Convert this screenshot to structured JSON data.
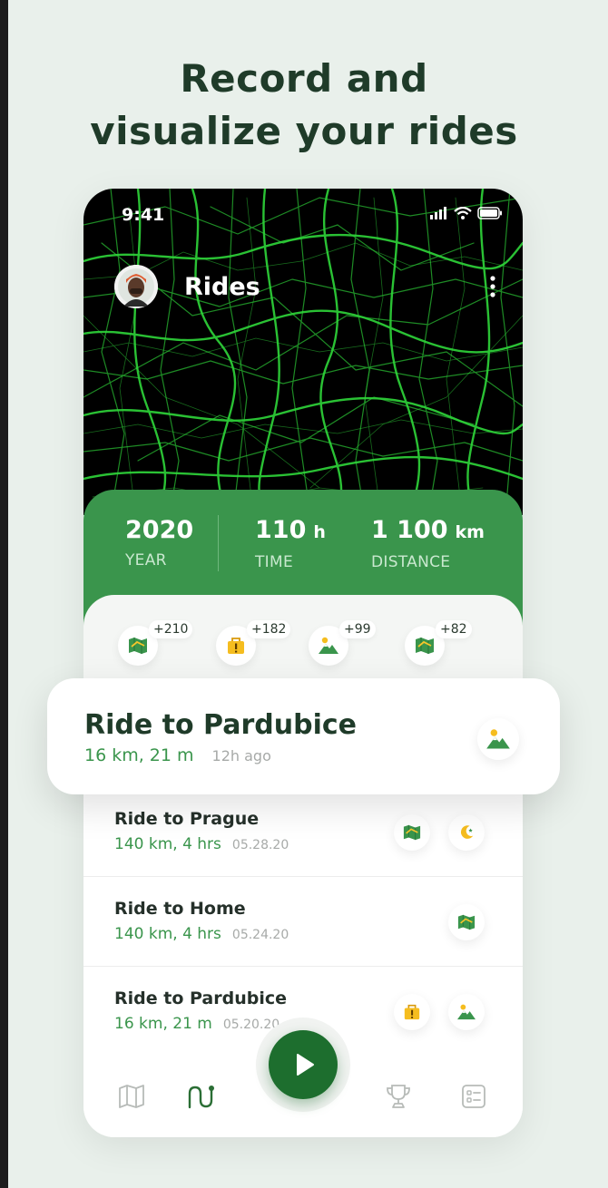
{
  "headline": {
    "line1": "Record and",
    "line2": "visualize your rides"
  },
  "status_bar": {
    "time": "9:41",
    "icons": [
      "signal-icon",
      "wifi-icon",
      "battery-icon"
    ]
  },
  "header": {
    "title": "Rides",
    "avatar": "avatar",
    "menu_icon": "more-vertical-icon"
  },
  "stats": {
    "year": {
      "value": "2020",
      "label": "YEAR"
    },
    "time": {
      "value": "110",
      "unit": "h",
      "label": "TIME"
    },
    "distance": {
      "value": "1 100",
      "unit": "km",
      "label": "DISTANCE"
    }
  },
  "badges": [
    {
      "icon": "map-icon",
      "count": "+210"
    },
    {
      "icon": "warning-bag-icon",
      "count": "+182"
    },
    {
      "icon": "mountain-icon",
      "count": "+99"
    },
    {
      "icon": "map-icon",
      "count": "+82"
    }
  ],
  "highlight_ride": {
    "name": "Ride to Pardubice",
    "distance_time": "16 km, 21 m",
    "ago": "12h ago",
    "icon": "mountain-icon"
  },
  "rides": [
    {
      "name": "Ride to Prague",
      "distance_time": "140 km, 4 hrs",
      "date": "05.28.20",
      "icons": [
        "map-icon",
        "moon-icon"
      ]
    },
    {
      "name": "Ride to Home",
      "distance_time": "140 km, 4 hrs",
      "date": "05.24.20",
      "icons": [
        "map-icon"
      ]
    },
    {
      "name": "Ride to Pardubice",
      "distance_time": "16 km, 21 m",
      "date": "05.20.20",
      "icons": [
        "warning-bag-icon",
        "mountain-icon"
      ]
    }
  ],
  "bottom_nav": {
    "items": [
      "map-nav-icon",
      "route-nav-icon",
      "play-icon",
      "trophy-icon",
      "checklist-icon"
    ],
    "active": "route-nav-icon"
  },
  "colors": {
    "accent": "#3a954c",
    "dark_green": "#1d6e2e",
    "headline": "#1f3b29",
    "background": "#e9f0eb",
    "map_lines": "#2fd63a"
  }
}
